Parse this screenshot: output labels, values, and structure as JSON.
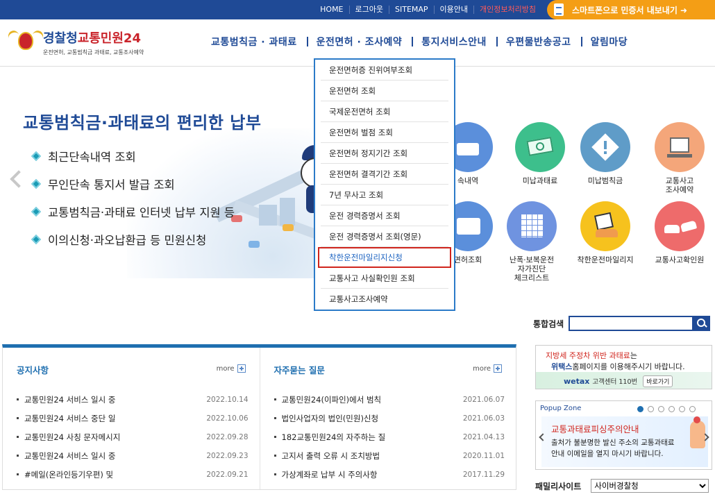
{
  "topbar": {
    "links": [
      "HOME",
      "로그아웃",
      "SITEMAP",
      "이용안내",
      "개인정보처리방침"
    ],
    "smartphone_label": "스마트폰으로 민증서 내보내기 ➜"
  },
  "logo": {
    "name_part1": "경찰청",
    "name_part2": "교통민원24",
    "subtitle": "운전면허, 교통범칙금 과태료, 교통조사예약"
  },
  "nav": [
    "교통범칙금 · 과태료",
    "운전면허 · 조사예약",
    "통지서비스안내",
    "우편물반송공고",
    "알림마당"
  ],
  "dropdown": {
    "items": [
      "운전면허증 진위여부조회",
      "운전면허 조회",
      "국제운전면허 조회",
      "운전면허 벌점 조회",
      "운전면허 정지기간 조회",
      "운전면허 결격기간 조회",
      "7년 무사고 조회",
      "운전 경력증명서 조회",
      "운전 경력증명서 조회(영문)",
      "착한운전마일리지신청",
      "교통사고 사실확인원 조회",
      "교통사고조사예약"
    ],
    "selected_index": 9
  },
  "hero": {
    "title": "교통범칙금·과태료의 편리한 납부",
    "items": [
      "최근단속내역 조회",
      "무인단속 통지서 발급 조회",
      "교통범칙금·과태료 인터넷 납부 지원 등",
      "이의신청·과오납환급 등 민원신청"
    ]
  },
  "quick": [
    {
      "label": "속내역",
      "color": "#5b8fdb",
      "icon": "camera-icon"
    },
    {
      "label": "미납과태료",
      "color": "#3dbf8c",
      "icon": "money-icon"
    },
    {
      "label": "미납범칙금",
      "color": "#5f9cc8",
      "icon": "warning-icon"
    },
    {
      "label": "교통사고\n조사예약",
      "color": "#f4a67a",
      "icon": "computer-icon"
    },
    {
      "label": "면허조회",
      "color": "#5b8fdb",
      "icon": "license-icon"
    },
    {
      "label": "난폭·보복운전\n자가진단\n체크리스트",
      "color": "#6f93e0",
      "icon": "checklist-icon"
    },
    {
      "label": "착한운전마일리지",
      "color": "#f6c21e",
      "icon": "mileage-icon"
    },
    {
      "label": "교통사고확인원",
      "color": "#ee6b6b",
      "icon": "crash-icon"
    }
  ],
  "search": {
    "label": "통합검색",
    "value": ""
  },
  "notice": {
    "title": "공지사항",
    "more": "more",
    "items": [
      {
        "title": "교통민원24 서비스 일시 중",
        "date": "2022.10.14"
      },
      {
        "title": "교통민원24 서비스 중단 일",
        "date": "2022.10.06"
      },
      {
        "title": "교통민원24 사칭 문자메시지",
        "date": "2022.09.28"
      },
      {
        "title": "교통민원24 서비스 일시 중",
        "date": "2022.09.23"
      },
      {
        "title": "#메일(온라인등기우편) 및",
        "date": "2022.09.21"
      }
    ]
  },
  "faq": {
    "title": "자주묻는 질문",
    "more": "more",
    "items": [
      {
        "title": "교통민원24(이파인)에서 범칙",
        "date": "2021.06.07"
      },
      {
        "title": "법인사업자의 법인(민원)신청",
        "date": "2021.06.03"
      },
      {
        "title": "182교통민원24의 자주하는 질",
        "date": "2021.04.13"
      },
      {
        "title": "고지서 출력 오류 시 조치방법",
        "date": "2020.11.01"
      },
      {
        "title": "가상계좌로 납부 시 주의사항",
        "date": "2017.11.29"
      }
    ]
  },
  "wetax": {
    "line1_red": "지방세 주정차 위반 과태료",
    "line1_rest": "는",
    "line2_bold": "위택스",
    "line2_rest": "홈페이지를 이용해주시기 바랍니다.",
    "logo": "wetax",
    "contact": "고객센터 110번",
    "go": "바로가기"
  },
  "popup": {
    "zone_label": "Popup Zone",
    "dots": 6,
    "active_dot": 0,
    "title": "교통과태료피싱주의안내",
    "desc1": "출처가 불분명한 발신 주소의 교통과태료",
    "desc2": "안내 이메일을 열지 마시기 바랍니다."
  },
  "family": {
    "label": "패밀리사이트",
    "selected": "사이버경찰청"
  }
}
